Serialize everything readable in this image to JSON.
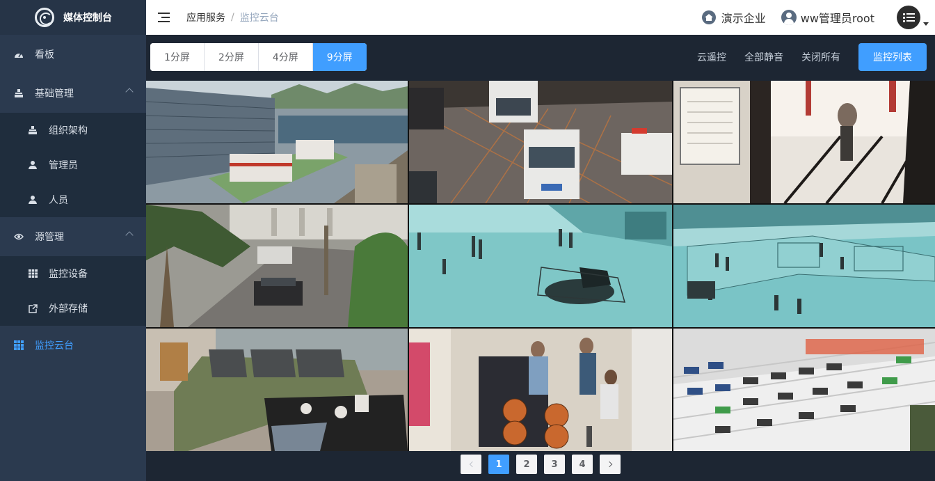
{
  "app": {
    "title": "媒体控制台"
  },
  "sidebar": {
    "items": [
      {
        "label": "看板",
        "icon": "dashboard-icon"
      },
      {
        "label": "基础管理",
        "icon": "org-tree-icon",
        "expanded": true,
        "children": [
          {
            "label": "组织架构",
            "icon": "org-tree-icon"
          },
          {
            "label": "管理员",
            "icon": "user-icon"
          },
          {
            "label": "人员",
            "icon": "user-icon"
          }
        ]
      },
      {
        "label": "源管理",
        "icon": "eye-icon",
        "expanded": true,
        "children": [
          {
            "label": "监控设备",
            "icon": "table-icon"
          },
          {
            "label": "外部存储",
            "icon": "external-link-icon"
          }
        ]
      },
      {
        "label": "监控云台",
        "icon": "grid-icon",
        "active": true
      }
    ]
  },
  "header": {
    "breadcrumb": [
      "应用服务",
      "监控云台"
    ],
    "company": "演示企业",
    "user": "ww管理员root"
  },
  "toolbar": {
    "layouts": [
      "1分屏",
      "2分屏",
      "4分屏",
      "9分屏"
    ],
    "active_layout": "9分屏",
    "links": [
      "云遥控",
      "全部静音",
      "关闭所有"
    ],
    "primary": "监控列表"
  },
  "pagination": {
    "pages": [
      "1",
      "2",
      "3",
      "4"
    ],
    "current": "1"
  },
  "colors": {
    "accent": "#409eff",
    "sidebar": "#2b3a4f",
    "sidebar_dark": "#1f2d3d",
    "main_bg": "#1d2633"
  }
}
